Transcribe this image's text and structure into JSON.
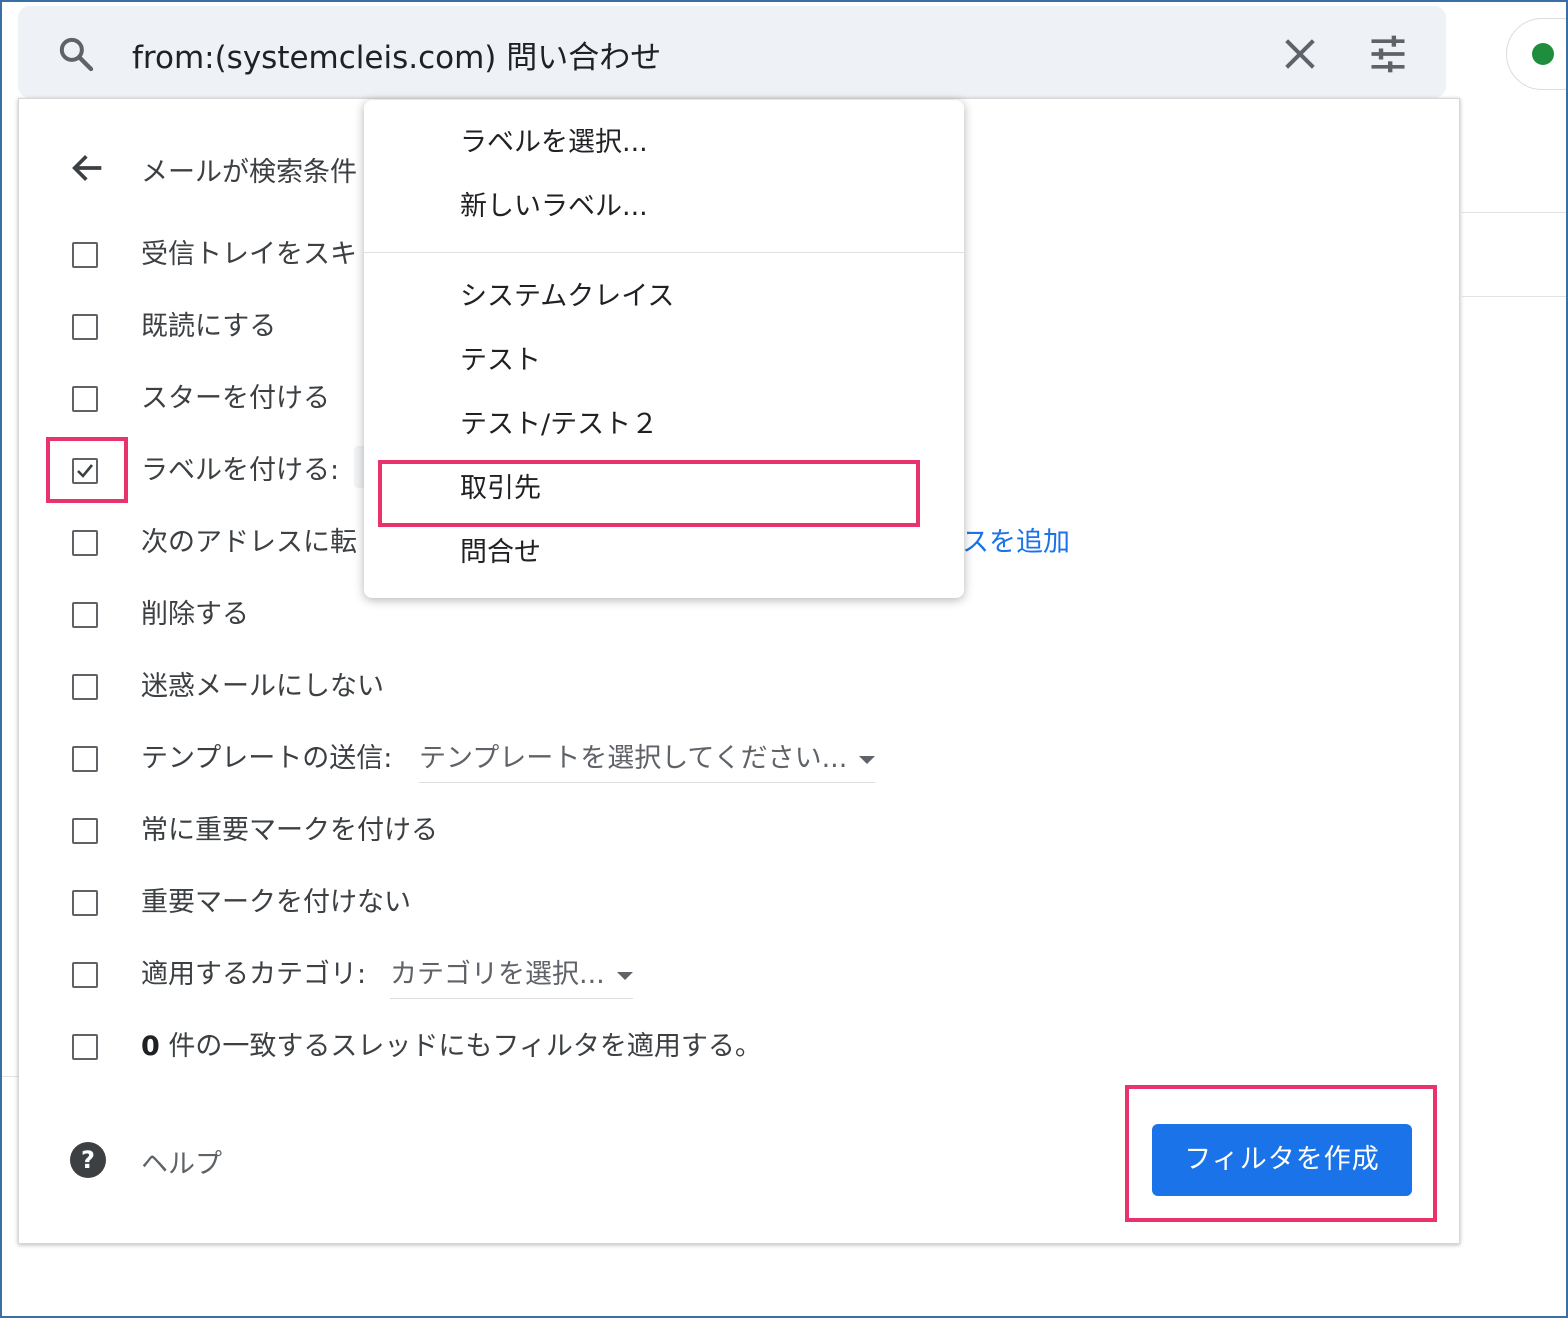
{
  "search": {
    "query": "from:(systemcleis.com) 問い合わせ"
  },
  "panel": {
    "header_text": "メールが検索条件",
    "options": [
      {
        "label": "受信トレイをスキ",
        "checked": false
      },
      {
        "label": "既読にする",
        "checked": false
      },
      {
        "label": "スターを付ける",
        "checked": false
      },
      {
        "label": "ラベルを付ける:",
        "checked": true
      },
      {
        "label": "次のアドレスに転",
        "checked": false
      },
      {
        "label": "削除する",
        "checked": false
      },
      {
        "label": "迷惑メールにしない",
        "checked": false
      },
      {
        "label": "テンプレートの送信:",
        "checked": false
      },
      {
        "label": "常に重要マークを付ける",
        "checked": false
      },
      {
        "label": "重要マークを付けない",
        "checked": false
      },
      {
        "label": "適用するカテゴリ:",
        "checked": false
      },
      {
        "label_count": "0",
        "label_rest": " 件の一致するスレッドにもフィルタを適用する。",
        "checked": false
      }
    ],
    "forward_add_link": "スを追加",
    "template_select": "テンプレートを選択してください...",
    "category_select": "カテゴリを選択...",
    "help_label": "ヘルプ",
    "help_icon_glyph": "?",
    "create_button": "フィルタを作成"
  },
  "dropdown": {
    "items_top": [
      "ラベルを選択...",
      "新しいラベル..."
    ],
    "items_labels": [
      "システムクレイス",
      "テスト",
      "テスト/テスト２",
      "取引先",
      "問合せ"
    ],
    "highlighted_item": "取引先"
  },
  "colors": {
    "accent": "#1a73e8",
    "highlight": "#e8336d",
    "status": "#1e8e3e"
  }
}
